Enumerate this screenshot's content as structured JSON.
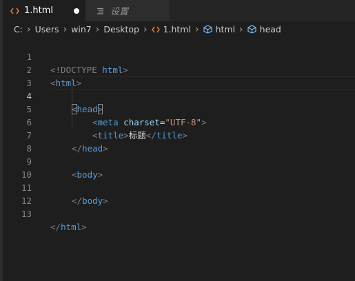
{
  "colors": {
    "accent_html_icon": "#e37933",
    "tag": "#569cd6",
    "punctuation": "#808080",
    "attribute": "#9cdcfe",
    "string": "#ce9178",
    "text": "#d4d4d4",
    "box_icon": "#75beff"
  },
  "tabs": [
    {
      "label": "1.html",
      "icon": "html-brackets-icon",
      "modified": true
    },
    {
      "label": "设置",
      "icon": "settings-lines-icon"
    }
  ],
  "breadcrumbs": [
    "C:",
    "Users",
    "win7",
    "Desktop",
    "1.html",
    "html",
    "head"
  ],
  "editor": {
    "active_line": 4,
    "line_numbers": [
      "1",
      "2",
      "3",
      "4",
      "5",
      "6",
      "7",
      "8",
      "9",
      "10",
      "11",
      "12",
      "13"
    ],
    "code": {
      "doctype_open": "<!DOCTYPE ",
      "doctype_name": "html",
      "doctype_close": ">",
      "lt": "<",
      "gt": ">",
      "lt_slash": "</",
      "eq": "=",
      "html": "html",
      "head": "head",
      "meta": "meta",
      "charset": "charset",
      "utf8": "\"UTF-8\"",
      "title": "title",
      "title_text": "标题",
      "body": "body"
    }
  }
}
